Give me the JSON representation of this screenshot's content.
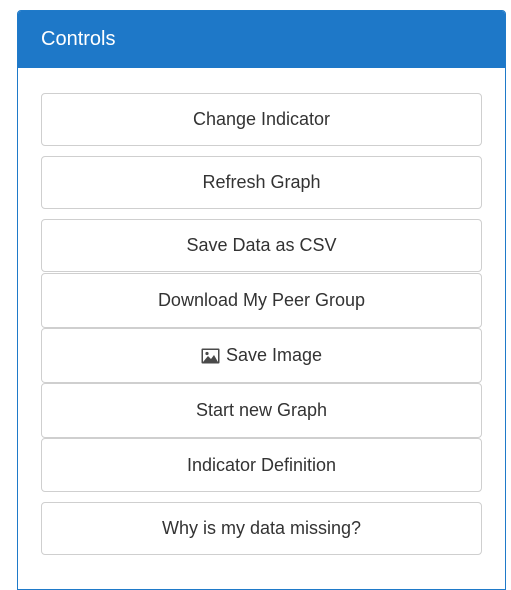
{
  "panel": {
    "title": "Controls"
  },
  "buttons": [
    {
      "label": "Change Indicator"
    },
    {
      "label": "Refresh Graph"
    },
    {
      "label": "Save Data as CSV"
    },
    {
      "label": "Download My Peer Group"
    },
    {
      "label": "Save Image",
      "icon": "picture-icon"
    },
    {
      "label": "Start new Graph"
    },
    {
      "label": "Indicator Definition"
    },
    {
      "label": "Why is my data missing?"
    }
  ],
  "colors": {
    "heading_bg": "#1e78c8",
    "heading_text": "#ffffff",
    "button_border": "#cfcfcf",
    "button_text": "#333333"
  }
}
